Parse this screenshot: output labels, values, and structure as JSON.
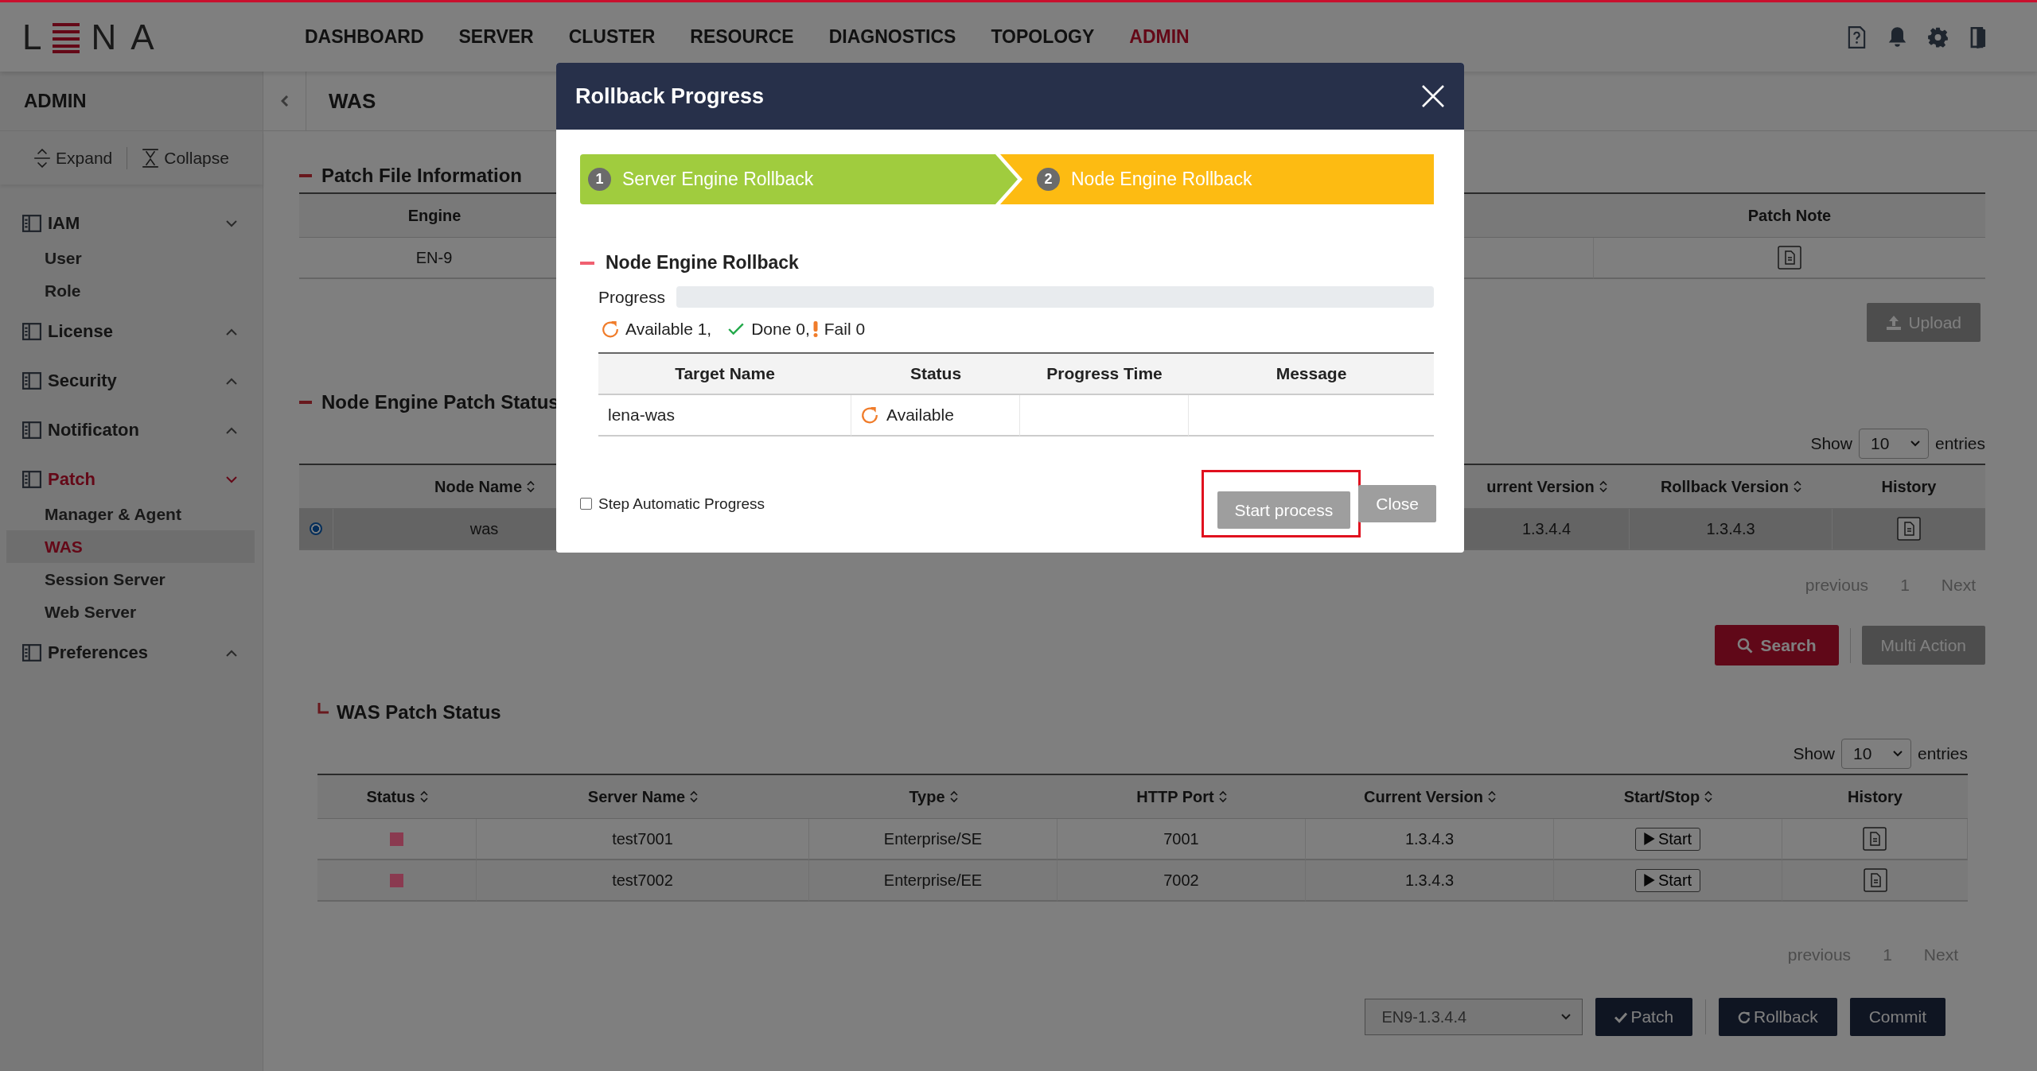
{
  "topbar": {
    "logo": {
      "left": "L",
      "right": "NA"
    },
    "nav": [
      {
        "label": "DASHBOARD",
        "selected": false
      },
      {
        "label": "SERVER",
        "selected": false
      },
      {
        "label": "CLUSTER",
        "selected": false
      },
      {
        "label": "RESOURCE",
        "selected": false
      },
      {
        "label": "DIAGNOSTICS",
        "selected": false
      },
      {
        "label": "TOPOLOGY",
        "selected": false
      },
      {
        "label": "ADMIN",
        "selected": true
      }
    ]
  },
  "sidebar": {
    "title": "ADMIN",
    "tools": [
      {
        "kind": "expand",
        "label": "Expand"
      },
      {
        "kind": "collapse",
        "label": "Collapse"
      }
    ],
    "groups": [
      {
        "label": "IAM",
        "expanded": true,
        "selected": false,
        "children": [
          {
            "label": "User",
            "selected": false
          },
          {
            "label": "Role",
            "selected": false
          }
        ]
      },
      {
        "label": "License",
        "expanded": false,
        "selected": false
      },
      {
        "label": "Security",
        "expanded": false,
        "selected": false
      },
      {
        "label": "Notificaton",
        "expanded": false,
        "selected": false
      },
      {
        "label": "Patch",
        "expanded": true,
        "selected": true,
        "children": [
          {
            "label": "Manager & Agent",
            "selected": false
          },
          {
            "label": "WAS",
            "selected": true
          },
          {
            "label": "Session Server",
            "selected": false
          },
          {
            "label": "Web Server",
            "selected": false
          }
        ]
      },
      {
        "label": "Preferences",
        "expanded": false,
        "selected": false
      }
    ]
  },
  "page": {
    "title": "WAS"
  },
  "patch_file_info": {
    "title": "Patch File Information",
    "columns": [
      "Engine",
      "Patch Note"
    ],
    "rows": [
      {
        "engine": "EN-9"
      }
    ],
    "upload": "Upload"
  },
  "node_engine_patch_status": {
    "title": "Node Engine Patch Status",
    "show": "Show",
    "page_size": "10",
    "entries": "entries",
    "columns": [
      {
        "label": "Node Name",
        "sortable": true
      },
      {
        "label": "urrent Version",
        "sortable": true
      },
      {
        "label": "Rollback Version",
        "sortable": true
      },
      {
        "label": "History",
        "sortable": false
      }
    ],
    "rows": [
      {
        "selected": true,
        "node_name": "was",
        "current_version": "1.3.4.4",
        "rollback_version": "1.3.4.3"
      }
    ],
    "pagination": {
      "previous": "previous",
      "page": "1",
      "next": "Next"
    },
    "buttons": [
      {
        "kind": "search",
        "label": "Search"
      },
      {
        "kind": "plain",
        "label": "Multi Action"
      }
    ]
  },
  "was_patch_status": {
    "title": "WAS Patch Status",
    "show": "Show",
    "page_size": "10",
    "entries": "entries",
    "columns": [
      {
        "label": "Status",
        "sortable": true
      },
      {
        "label": "Server Name",
        "sortable": true
      },
      {
        "label": "Type",
        "sortable": true
      },
      {
        "label": "HTTP Port",
        "sortable": true
      },
      {
        "label": "Current Version",
        "sortable": true
      },
      {
        "label": "Start/Stop",
        "sortable": true
      },
      {
        "label": "History",
        "sortable": false
      }
    ],
    "rows": [
      {
        "color": "#8a3a50",
        "server_name": "test7001",
        "type": "Enterprise/SE",
        "http_port": "7001",
        "current_version": "1.3.4.3",
        "action": "Start"
      },
      {
        "color": "#8a3a50",
        "server_name": "test7002",
        "type": "Enterprise/EE",
        "http_port": "7002",
        "current_version": "1.3.4.3",
        "action": "Start"
      }
    ],
    "pagination": {
      "previous": "previous",
      "page": "1",
      "next": "Next"
    },
    "version_select": "EN9-1.3.4.4",
    "buttons": [
      {
        "kind": "patch",
        "label": "Patch"
      },
      {
        "kind": "rollback",
        "label": "Rollback"
      },
      {
        "kind": "plain",
        "label": "Commit"
      }
    ]
  },
  "modal": {
    "title": "Rollback Progress",
    "steps": [
      {
        "number": "1",
        "label": "Server Engine Rollback",
        "active": false
      },
      {
        "number": "2",
        "label": "Node Engine Rollback",
        "active": true
      }
    ],
    "section": "Node Engine Rollback",
    "progress": {
      "label": "Progress",
      "level": 0
    },
    "summary": [
      {
        "kind": "available",
        "text": "Available 1,"
      },
      {
        "kind": "done",
        "text": "Done 0,"
      },
      {
        "kind": "fail",
        "text": "Fail 0"
      }
    ],
    "table": {
      "columns": [
        "Target Name",
        "Status",
        "Progress Time",
        "Message"
      ],
      "rows": [
        {
          "target_name": "lena-was",
          "status": {
            "kind": "available",
            "text": "Available"
          }
        }
      ]
    },
    "auto_progress": {
      "label": "Step Automatic Progress",
      "checked": false
    },
    "buttons": [
      {
        "label": "Start process",
        "highlighted": true
      },
      {
        "label": "Close",
        "highlighted": false
      }
    ]
  }
}
